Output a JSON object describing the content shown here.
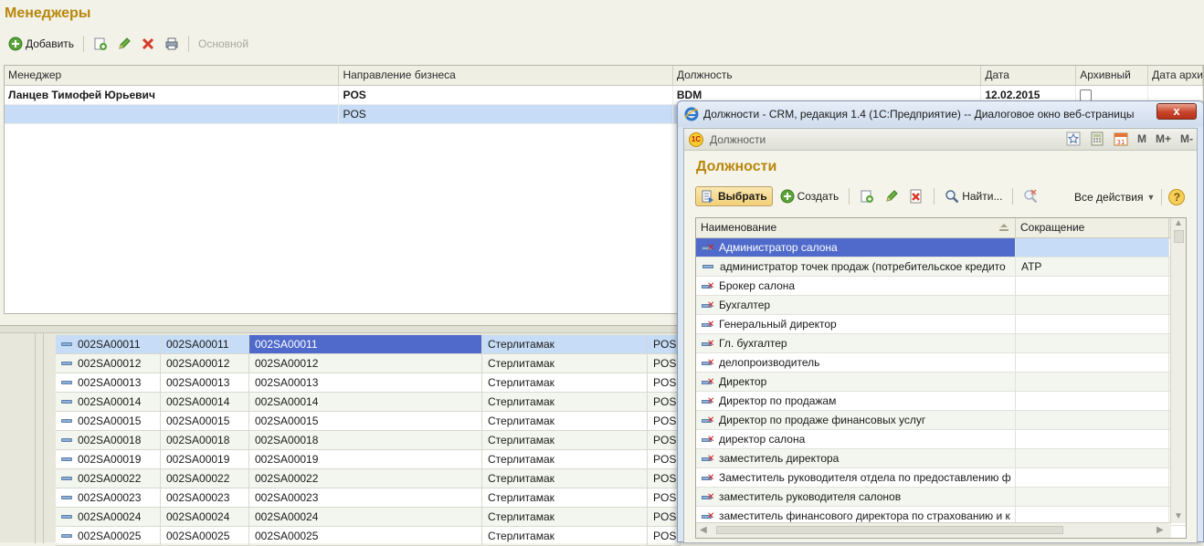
{
  "page": {
    "title": "Менеджеры",
    "toolbar": {
      "add_label": "Добавить",
      "primary_label": "Основной"
    },
    "grid": {
      "columns": [
        "Менеджер",
        "Направление бизнеса",
        "Должность",
        "Дата",
        "Архивный",
        "Дата архи"
      ],
      "rows": [
        {
          "manager": "Ланцев Тимофей Юрьевич",
          "direction": "POS",
          "position": "BDM",
          "date": "12.02.2015",
          "archived": false
        },
        {
          "manager": "",
          "direction": "POS",
          "position": "",
          "date": "",
          "archived": null
        }
      ]
    }
  },
  "bottom_list": {
    "rows": [
      {
        "c1": "002SA00011",
        "c2": "002SA00011",
        "c3": "002SA00011",
        "city": "Стерлитамак",
        "dir": "POS"
      },
      {
        "c1": "002SA00012",
        "c2": "002SA00012",
        "c3": "002SA00012",
        "city": "Стерлитамак",
        "dir": "POS"
      },
      {
        "c1": "002SA00013",
        "c2": "002SA00013",
        "c3": "002SA00013",
        "city": "Стерлитамак",
        "dir": "POS"
      },
      {
        "c1": "002SA00014",
        "c2": "002SA00014",
        "c3": "002SA00014",
        "city": "Стерлитамак",
        "dir": "POS"
      },
      {
        "c1": "002SA00015",
        "c2": "002SA00015",
        "c3": "002SA00015",
        "city": "Стерлитамак",
        "dir": "POS"
      },
      {
        "c1": "002SA00018",
        "c2": "002SA00018",
        "c3": "002SA00018",
        "city": "Стерлитамак",
        "dir": "POS"
      },
      {
        "c1": "002SA00019",
        "c2": "002SA00019",
        "c3": "002SA00019",
        "city": "Стерлитамак",
        "dir": "POS"
      },
      {
        "c1": "002SA00022",
        "c2": "002SA00022",
        "c3": "002SA00022",
        "city": "Стерлитамак",
        "dir": "POS"
      },
      {
        "c1": "002SA00023",
        "c2": "002SA00023",
        "c3": "002SA00023",
        "city": "Стерлитамак",
        "dir": "POS"
      },
      {
        "c1": "002SA00024",
        "c2": "002SA00024",
        "c3": "002SA00024",
        "city": "Стерлитамак",
        "dir": "POS"
      },
      {
        "c1": "002SA00025",
        "c2": "002SA00025",
        "c3": "002SA00025",
        "city": "Стерлитамак",
        "dir": "POS"
      }
    ]
  },
  "dialog": {
    "window_title": "Должности - CRM, редакция 1.4 (1С:Предприятие) -- Диалоговое окно веб-страницы",
    "close_label": "x",
    "bar_title": "Должности",
    "bar_tools": {
      "m": "M",
      "m_plus": "M+",
      "m_minus": "M-"
    },
    "heading": "Должности",
    "toolbar": {
      "select_label": "Выбрать",
      "create_label": "Создать",
      "find_label": "Найти...",
      "all_actions_label": "Все действия",
      "help_label": "?"
    },
    "grid": {
      "columns": [
        "Наименование",
        "Сокращение"
      ],
      "rows": [
        {
          "name": "Администратор салона",
          "abbr": "",
          "deleted": true
        },
        {
          "name": "администратор точек продаж (потребительское кредито",
          "abbr": "АТР",
          "deleted": false
        },
        {
          "name": "Брокер салона",
          "abbr": "",
          "deleted": true
        },
        {
          "name": "Бухгалтер",
          "abbr": "",
          "deleted": true
        },
        {
          "name": "Генеральный директор",
          "abbr": "",
          "deleted": true
        },
        {
          "name": "Гл. бухгалтер",
          "abbr": "",
          "deleted": true
        },
        {
          "name": "делопроизводитель",
          "abbr": "",
          "deleted": true
        },
        {
          "name": "Директор",
          "abbr": "",
          "deleted": true
        },
        {
          "name": "Директор по продажам",
          "abbr": "",
          "deleted": true
        },
        {
          "name": "Директор по продаже финансовых услуг",
          "abbr": "",
          "deleted": true
        },
        {
          "name": "директор салона",
          "abbr": "",
          "deleted": true
        },
        {
          "name": "заместитель директора",
          "abbr": "",
          "deleted": true
        },
        {
          "name": "Заместитель руководителя отдела по предоставлению ф",
          "abbr": "",
          "deleted": true
        },
        {
          "name": "заместитель руководителя салонов",
          "abbr": "",
          "deleted": true
        },
        {
          "name": "заместитель финансового директора по страхованию и к",
          "abbr": "",
          "deleted": true
        }
      ]
    }
  }
}
